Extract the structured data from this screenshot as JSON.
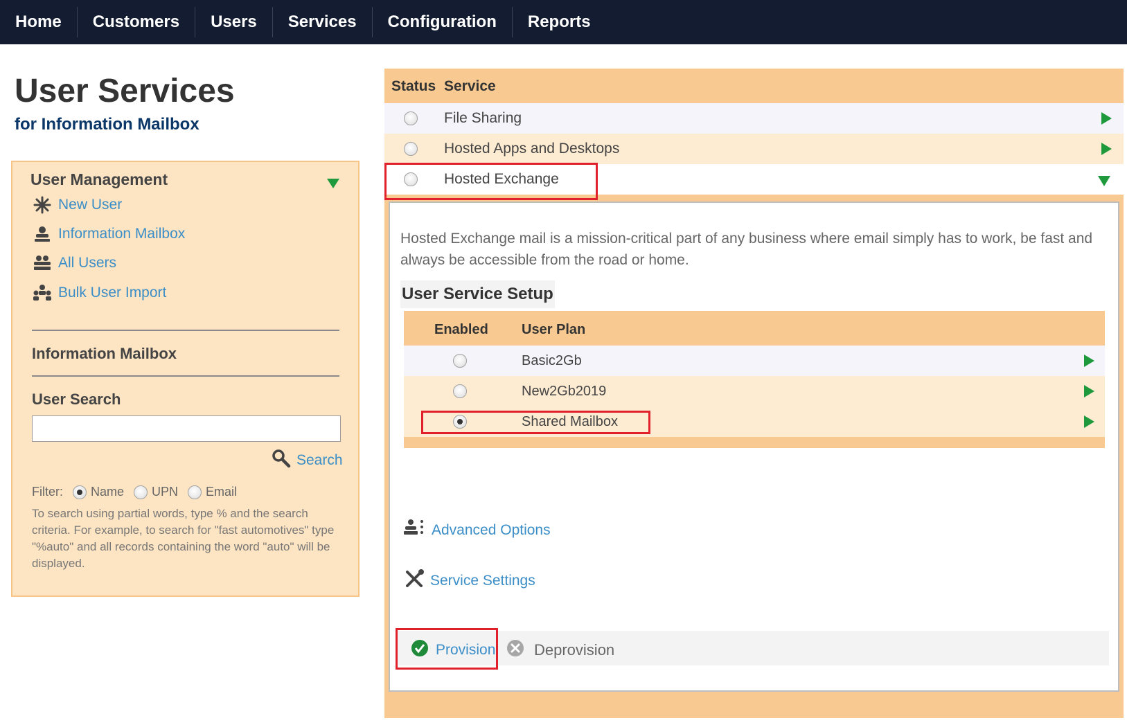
{
  "nav": {
    "items": [
      "Home",
      "Customers",
      "Users",
      "Services",
      "Configuration",
      "Reports"
    ]
  },
  "page": {
    "title": "User Services",
    "subtitle": "for Information Mailbox"
  },
  "left_panel": {
    "user_management": {
      "heading": "User Management",
      "links": [
        {
          "label": "New User",
          "icon": "new-user-icon"
        },
        {
          "label": "Information Mailbox",
          "icon": "user-icon"
        },
        {
          "label": "All Users",
          "icon": "users-icon"
        },
        {
          "label": "Bulk User Import",
          "icon": "bulk-import-icon"
        }
      ]
    },
    "section_mailbox": "Information Mailbox",
    "user_search": {
      "heading": "User Search",
      "input_value": "",
      "search_label": "Search",
      "filter_label": "Filter:",
      "filter_options": [
        {
          "label": "Name",
          "checked": true
        },
        {
          "label": "UPN",
          "checked": false
        },
        {
          "label": "Email",
          "checked": false
        }
      ],
      "help_text": "To search using partial words, type % and the search criteria. For example, to search for \"fast automotives\" type \"%auto\" and all records containing the word \"auto\" will be displayed."
    }
  },
  "services": {
    "headers": {
      "status": "Status",
      "service": "Service"
    },
    "rows": [
      {
        "name": "File Sharing",
        "bg": "#f4f4fa",
        "expanded": false
      },
      {
        "name": "Hosted Apps and Desktops",
        "bg": "#fdebd2",
        "expanded": false
      },
      {
        "name": "Hosted Exchange",
        "bg": "#ffffff",
        "expanded": true
      }
    ],
    "detail": {
      "description": "Hosted Exchange mail is a mission-critical part of any business where email simply has to work, be fast and always be accessible from the road or home.",
      "setup_title": "User Service Setup",
      "plan_headers": {
        "enabled": "Enabled",
        "plan": "User Plan"
      },
      "plans": [
        {
          "name": "Basic2Gb",
          "checked": false,
          "bg": "#f4f4fa"
        },
        {
          "name": "New2Gb2019",
          "checked": false,
          "bg": "#fdebd2"
        },
        {
          "name": "Shared Mailbox",
          "checked": true,
          "bg": "#fdebd2"
        }
      ],
      "advanced_options": "Advanced Options",
      "service_settings": "Service Settings",
      "provision": "Provision",
      "deprovision": "Deprovision"
    }
  },
  "colors": {
    "nav_bg": "#131c30",
    "accent_link": "#3b8ec7",
    "arrow_green": "#1e9a3c",
    "highlight_red": "#e0202a",
    "panel_orange": "#f8ca91"
  }
}
